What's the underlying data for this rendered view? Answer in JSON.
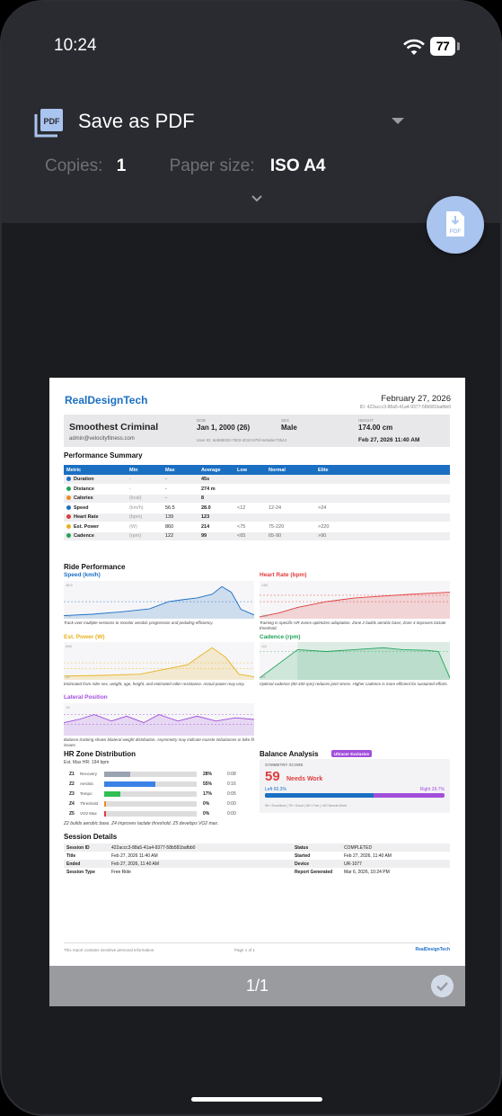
{
  "status": {
    "time": "10:24",
    "battery": "77"
  },
  "print": {
    "destination": "Save as PDF",
    "copies_label": "Copies:",
    "copies": "1",
    "paper_label": "Paper size:",
    "paper": "ISO A4",
    "page_count": "1/1"
  },
  "report": {
    "brand": "RealDesignTech",
    "date": "February 27, 2026",
    "id_line": "ID: 422accc3-88a5-41a4-9377-58b581bafbb0",
    "user": {
      "name": "Smoothest Criminal",
      "email": "admin@velocityfitness.com",
      "dob_label": "DOB",
      "dob": "Jan 1, 2000 (26)",
      "sex_label": "SEX",
      "sex": "Male",
      "height_label": "HEIGHT",
      "height": "174.00 cm",
      "user_id": "User ID: 6e588033-7903-4010-975f-6e5abe73b44",
      "datetime": "Feb 27, 2026 11:40 AM"
    },
    "perf_title": "Performance Summary",
    "perf_headers": [
      "Metric",
      "Min",
      "Max",
      "Average",
      "Low",
      "Normal",
      "Elite"
    ],
    "perf_rows": [
      {
        "c": "#1a6fc3",
        "m": "Duration",
        "u": "",
        "min": "-",
        "max": "-",
        "avg": "45s",
        "lo": "",
        "no": "",
        "el": ""
      },
      {
        "c": "#22a35a",
        "m": "Distance",
        "u": "",
        "min": "-",
        "max": "-",
        "avg": "274 m",
        "lo": "",
        "no": "",
        "el": ""
      },
      {
        "c": "#f08a24",
        "m": "Calories",
        "u": "(kcal)",
        "min": "",
        "max": "-",
        "avg": "8",
        "lo": "",
        "no": "",
        "el": ""
      },
      {
        "c": "#1a6fc3",
        "m": "Speed",
        "u": "(km/h)",
        "min": "",
        "max": "56.5",
        "avg": "28.0",
        "lo": "<12",
        "no": "12-24",
        "el": ">24"
      },
      {
        "c": "#e03c3c",
        "m": "Heart Rate",
        "u": "(bpm)",
        "min": "",
        "max": "139",
        "avg": "123",
        "lo": "",
        "no": "",
        "el": ""
      },
      {
        "c": "#e8b21c",
        "m": "Est. Power",
        "u": "(W)",
        "min": "",
        "max": "860",
        "avg": "214",
        "lo": "<75",
        "no": "75-220",
        "el": ">220"
      },
      {
        "c": "#22a35a",
        "m": "Cadence",
        "u": "(rpm)",
        "min": "",
        "max": "122",
        "avg": "99",
        "lo": "<65",
        "no": "65-90",
        "el": ">90"
      }
    ],
    "ride_title": "Ride Performance",
    "charts": {
      "speed": {
        "title": "Speed (km/h)",
        "top": "48.5",
        "bottom": "7.4",
        "caption": "Track over multiple sessions to monitor aerobic progression and pedaling efficiency.",
        "color": "#1a6fc3"
      },
      "hr": {
        "title": "Heart Rate (bpm)",
        "top": "138",
        "bottom": "100",
        "caption": "Training in specific HR zones optimizes adaptation. Zone 2 builds aerobic base; Zone 4 improves lactate threshold.",
        "color": "#e03c3c"
      },
      "power": {
        "title": "Est. Power (W)",
        "top": "698",
        "bottom": "20",
        "caption": "Estimated from rider sex, weight, age, height, and estimated roller resistance. Actual power may vary.",
        "color": "#e8b21c"
      },
      "cadence": {
        "title": "Cadence (rpm)",
        "top": "111",
        "bottom": "49",
        "caption": "Optimal cadence (80-100 rpm) reduces joint stress. Higher cadence is more efficient for sustained efforts.",
        "color": "#22a35a"
      },
      "lateral": {
        "title": "Lateral Position",
        "top": "+6",
        "bottom": "",
        "caption": "Balance tracking shows bilateral weight distribution. Asymmetry may indicate muscle imbalances or bike fit issues.",
        "color": "#a24fdc"
      }
    },
    "hrz_title": "HR Zone Distribution",
    "hrz_sub": "Est. Max HR: 194 bpm",
    "zones": [
      {
        "z": "Z1",
        "n": "Recovery",
        "p": "28%",
        "t": "0:08",
        "c": "#9aa3b0",
        "f": 0.28
      },
      {
        "z": "Z2",
        "n": "Aerobic",
        "p": "55%",
        "t": "0:16",
        "c": "#3b82e6",
        "f": 0.55
      },
      {
        "z": "Z3",
        "n": "Tempo",
        "p": "17%",
        "t": "0:05",
        "c": "#2fbf55",
        "f": 0.17
      },
      {
        "z": "Z4",
        "n": "Threshold",
        "p": "0%",
        "t": "0:00",
        "c": "#f08a24",
        "f": 0.0
      },
      {
        "z": "Z5",
        "n": "VO2 Max",
        "p": "0%",
        "t": "0:00",
        "c": "#e03c3c",
        "f": 0.0
      }
    ],
    "hrz_caption": "Z2 builds aerobic base. Z4 improves lactate threshold. Z5 develops VO2 max.",
    "balance": {
      "title": "Balance Analysis",
      "badge": "Ultracer Exclusive",
      "score_label": "SYMMETRY SCORE",
      "score": "59",
      "verdict": "Needs Work",
      "left": "Left 60.3%",
      "right": "Right 39.7%",
      "left_frac": 0.603,
      "legend": "90+ Excellent | 75+ Good | 60+ Fair | <60 Needs Work"
    },
    "session_title": "Session Details",
    "session": [
      [
        "Session ID",
        "422accc3-88a5-41a4-9377-58b581bafbb0",
        "Status",
        "COMPLETED"
      ],
      [
        "Title",
        "Feb 27, 2026 11:40 AM",
        "Started",
        "Feb 27, 2026, 11:40 AM"
      ],
      [
        "Ended",
        "Feb 27, 2026, 11:40 AM",
        "Device",
        "UR-1077"
      ],
      [
        "Session Type",
        "Free Ride",
        "Report Generated",
        "Mar 6, 2026, 10:24 PM"
      ]
    ],
    "footer": {
      "left": "This report contains sensitive personal information.",
      "mid": "Page 1 of 1",
      "right": "RealDesignTech"
    }
  }
}
